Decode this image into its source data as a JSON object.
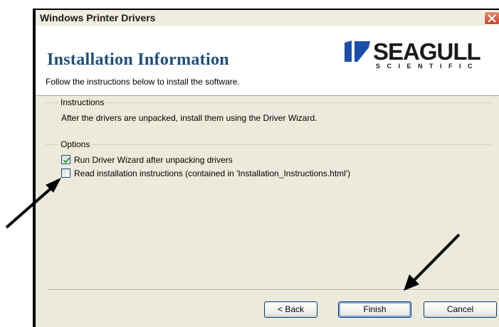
{
  "window": {
    "title": "Windows Printer Drivers"
  },
  "header": {
    "title": "Installation Information",
    "subtitle": "Follow the instructions below to install the software.",
    "logo": {
      "word": "SEAGULL",
      "sub": "SCIENTIFIC"
    }
  },
  "instructions": {
    "label": "Instructions",
    "text": "After the drivers are unpacked, install them using the Driver Wizard."
  },
  "options": {
    "label": "Options",
    "items": [
      {
        "label": "Run Driver Wizard after unpacking drivers",
        "checked": true
      },
      {
        "label": "Read installation instructions (contained in 'Installation_Instructions.html')",
        "checked": false
      }
    ]
  },
  "buttons": {
    "back": "< Back",
    "finish": "Finish",
    "cancel": "Cancel"
  },
  "colors": {
    "accent": "#1f4e79",
    "window_bg": "#eceadb",
    "button_border": "#003c74",
    "check": "#21a121"
  },
  "icons": [
    "close-icon",
    "checkmark-icon",
    "seagull-logo-mark",
    "annotation-arrow"
  ]
}
